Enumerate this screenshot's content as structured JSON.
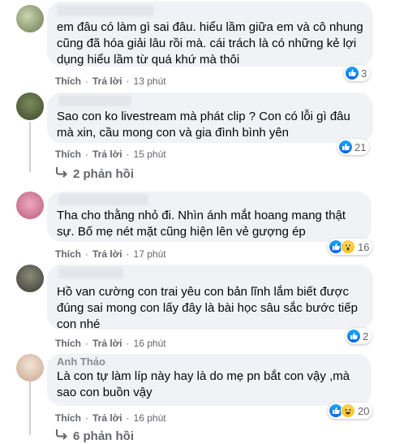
{
  "comments": [
    {
      "author": "",
      "text": "em đâu có làm gì sai đâu. hiểu lầm giữa em và cô nhung\ncũng đã hóa giải lâu rồi mà. cái trách là có những kẻ lợi\ndụng hiểu lầm từ quá khứ mà thôi",
      "like_label": "Thích",
      "reply_label": "Trả lời",
      "time": "13 phút",
      "reaction_count": "3",
      "reaction_icons": [
        "like-icon"
      ]
    },
    {
      "author": "",
      "text": "Sao con ko livestream mà phát clip ? Con có lỗi gì đâu\nmà xin, cầu mong con và gia đình bình yên",
      "like_label": "Thích",
      "reply_label": "Trả lời",
      "time": "15 phút",
      "reaction_count": "21",
      "reaction_icons": [
        "like-icon"
      ],
      "replies_label": "2 phản hồi"
    },
    {
      "author": "",
      "text": "Tha cho thằng nhỏ đi. Nhìn ánh mắt hoang mang thật\nsự. Bố mẹ nét mặt cũng hiện lên vẻ gượng ép",
      "like_label": "Thích",
      "reply_label": "Trả lời",
      "time": "17 phút",
      "reaction_count": "16",
      "reaction_icons": [
        "like-icon",
        "wow-icon"
      ]
    },
    {
      "author": "",
      "text": "Hồ van cường con trai yêu con bản lĩnh lắm biết được\nđúng sai mong con lấy đây là bài học sâu sắc bước tiếp\ncon nhé",
      "like_label": "Thích",
      "reply_label": "Trả lời",
      "time": "16 phút",
      "reaction_count": "2",
      "reaction_icons": [
        "like-icon"
      ]
    },
    {
      "author": "Anh Thảo",
      "text": "Là con tự làm líp này hay là do mẹ pn bắt con vậy ,mà\nsao con buồn vậy",
      "like_label": "Thích",
      "reply_label": "Trả lời",
      "time": "16 phút",
      "reaction_count": "20",
      "reaction_icons": [
        "like-icon",
        "haha-icon"
      ],
      "replies_label": "6 phản hồi"
    }
  ],
  "colors": {
    "like": "#1877f2",
    "bubble": "#f0f2f5",
    "meta": "#65676b"
  }
}
